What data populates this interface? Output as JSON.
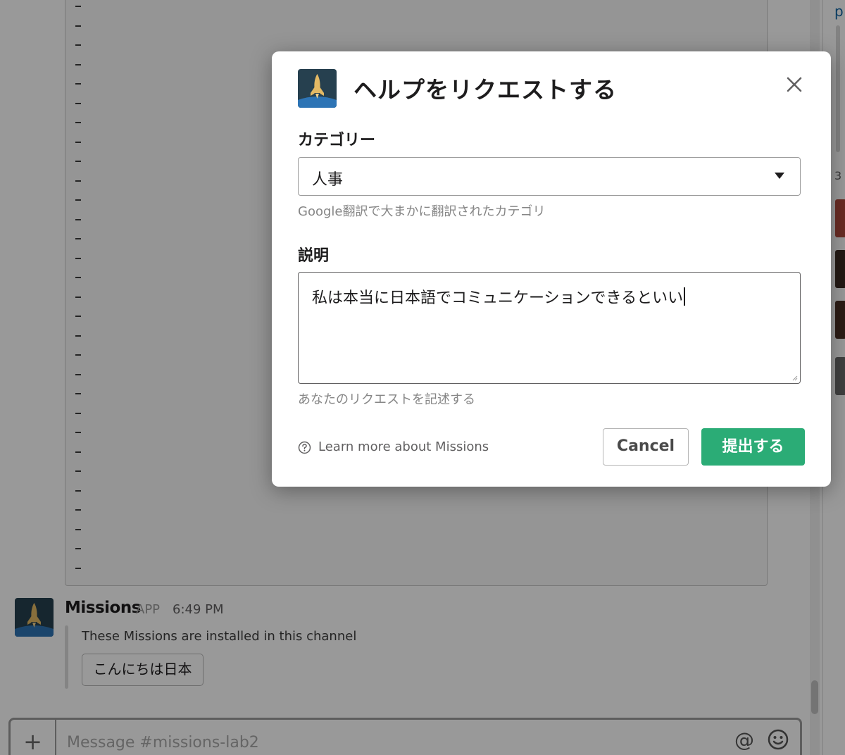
{
  "modal": {
    "title": "ヘルプをリクエストする",
    "category": {
      "label": "カテゴリー",
      "selected": "人事",
      "hint": "Google翻訳で大まかに翻訳されたカテゴリ"
    },
    "description": {
      "label": "説明",
      "value": "私は本当に日本語でコミュニケーションできるといい",
      "hint": "あなたのリクエストを記述する"
    },
    "learn_more": "Learn more about Missions",
    "cancel_label": "Cancel",
    "submit_label": "提出する",
    "accent_color": "#2bac76"
  },
  "message": {
    "sender": "Missions",
    "badge": "APP",
    "time": "6:49 PM",
    "attachment_text": "These Missions are installed in this channel",
    "mission_button": "こんにちは日本"
  },
  "composer": {
    "placeholder": "Message #missions-lab2",
    "plus": "+",
    "at": "@"
  },
  "right_panel": {
    "letter": "p",
    "count": "3"
  },
  "icons": [
    "rocket-app-icon",
    "close-icon",
    "chevron-down-icon",
    "help-circle-icon",
    "plus-icon",
    "at-icon",
    "emoji-icon"
  ]
}
